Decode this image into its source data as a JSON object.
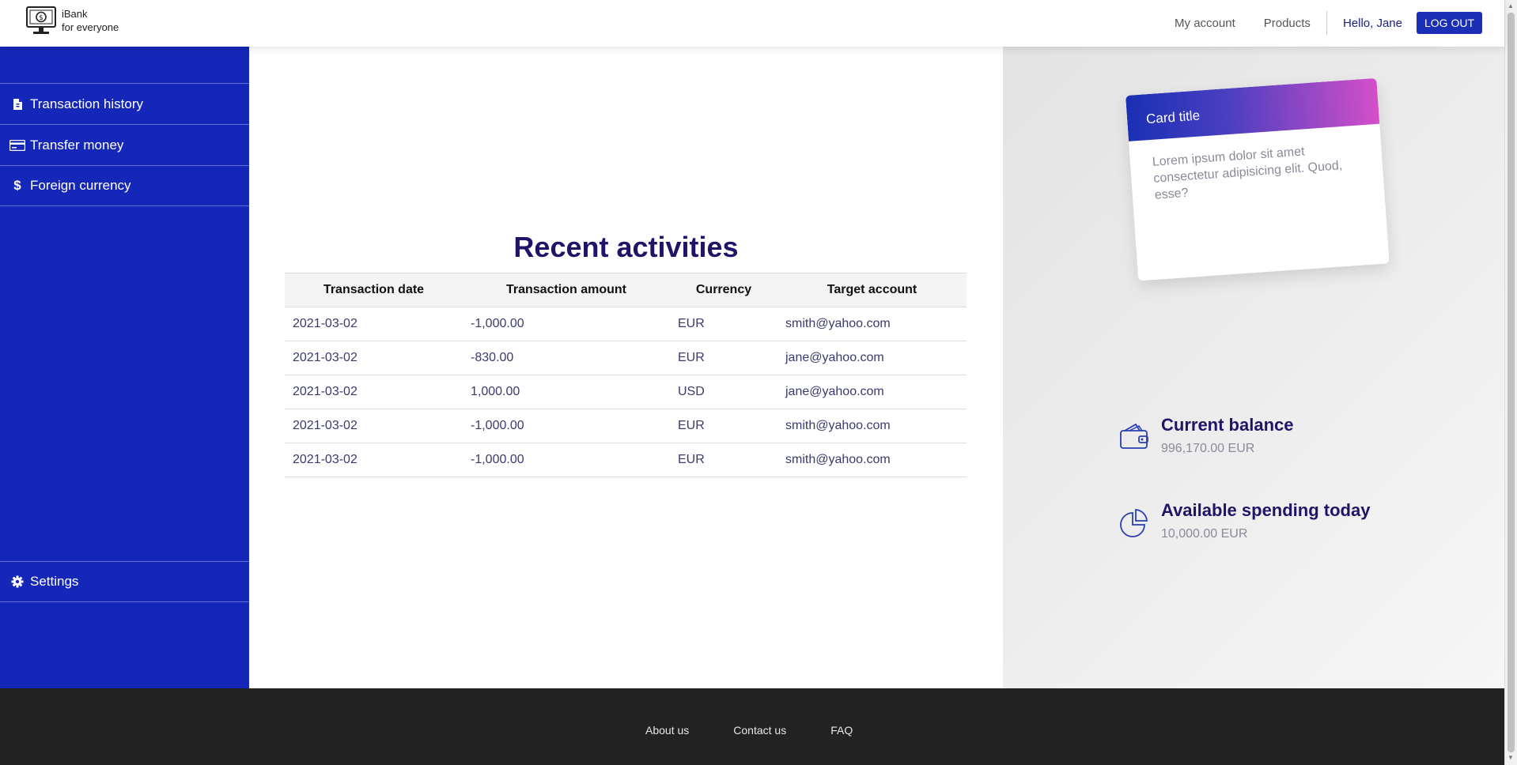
{
  "brand": {
    "line1": "iBank",
    "line2": "for everyone"
  },
  "nav": {
    "my_account": "My account",
    "products": "Products",
    "greeting": "Hello, Jane",
    "logout": "LOG OUT"
  },
  "sidebar": {
    "items": [
      {
        "label": "Transaction history",
        "icon": "document-icon"
      },
      {
        "label": "Transfer money",
        "icon": "credit-card-icon"
      },
      {
        "label": "Foreign currency",
        "icon": "dollar-icon"
      },
      {
        "label": "Settings",
        "icon": "gear-icon"
      }
    ]
  },
  "main": {
    "title": "Recent activities",
    "table": {
      "headers": [
        "Transaction date",
        "Transaction amount",
        "Currency",
        "Target account"
      ],
      "rows": [
        [
          "2021-03-02",
          "-1,000.00",
          "EUR",
          "smith@yahoo.com"
        ],
        [
          "2021-03-02",
          "-830.00",
          "EUR",
          "jane@yahoo.com"
        ],
        [
          "2021-03-02",
          "1,000.00",
          "USD",
          "jane@yahoo.com"
        ],
        [
          "2021-03-02",
          "-1,000.00",
          "EUR",
          "smith@yahoo.com"
        ],
        [
          "2021-03-02",
          "-1,000.00",
          "EUR",
          "smith@yahoo.com"
        ]
      ]
    }
  },
  "card": {
    "title": "Card title",
    "body": "Lorem ipsum dolor sit amet consectetur adipisicing elit. Quod, esse?"
  },
  "stats": {
    "balance": {
      "title": "Current balance",
      "value": "996,170.00 EUR",
      "icon": "wallet-icon"
    },
    "spending": {
      "title": "Available spending today",
      "value": "10,000.00 EUR",
      "icon": "pie-chart-icon"
    }
  },
  "footer": {
    "about": "About us",
    "contact": "Contact us",
    "faq": "FAQ"
  },
  "colors": {
    "primary": "#1527b9",
    "title": "#1f1466",
    "footer": "#222222"
  }
}
